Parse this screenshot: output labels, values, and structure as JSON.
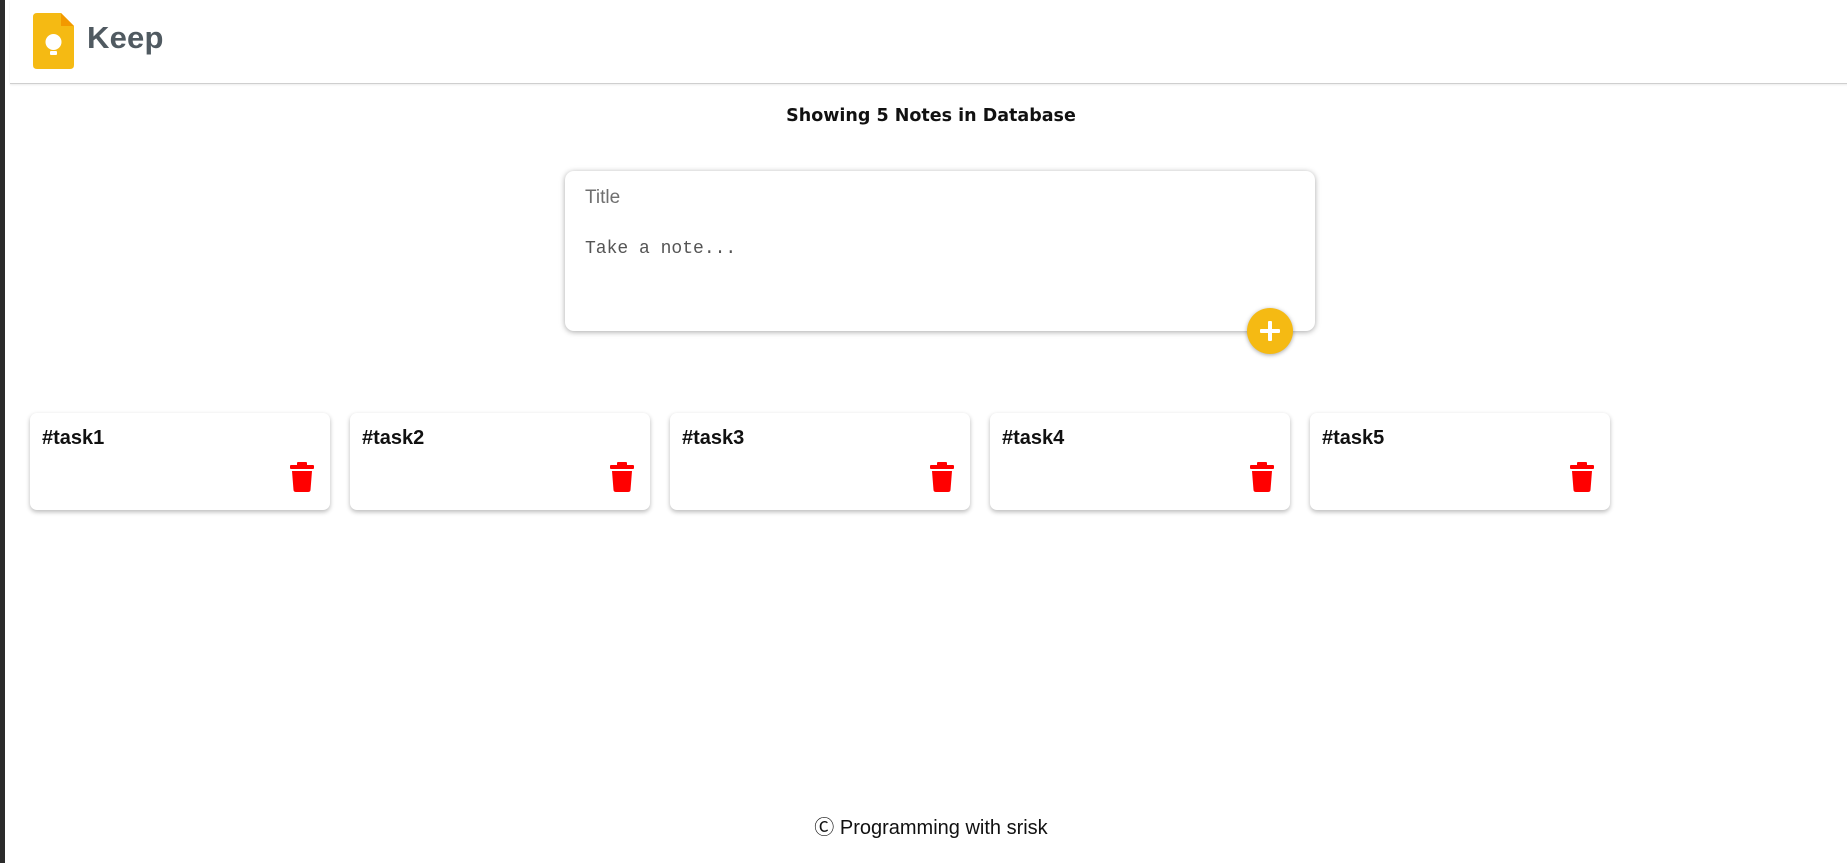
{
  "header": {
    "app_name": "Keep",
    "logo_icon": "keep-lightbulb-icon",
    "logo_color": "#f5ba13"
  },
  "summary": {
    "note_count_text": "Showing 5 Notes in Database"
  },
  "create_area": {
    "title_placeholder": "Title",
    "content_placeholder": "Take a note...",
    "add_icon": "plus-icon",
    "accent_color": "#f5ba13"
  },
  "notes": [
    {
      "title": "#task1",
      "delete_icon": "trash-icon"
    },
    {
      "title": "#task2",
      "delete_icon": "trash-icon"
    },
    {
      "title": "#task3",
      "delete_icon": "trash-icon"
    },
    {
      "title": "#task4",
      "delete_icon": "trash-icon"
    },
    {
      "title": "#task5",
      "delete_icon": "trash-icon"
    }
  ],
  "delete_color": "#ff0000",
  "footer": {
    "text": "Ⓒ Programming with srisk"
  }
}
